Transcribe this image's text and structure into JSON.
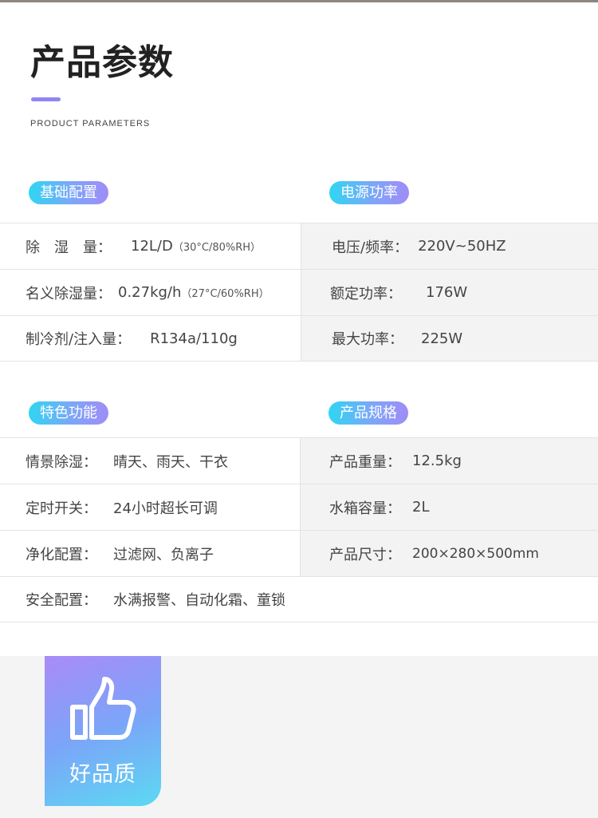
{
  "header": {
    "title": "产品参数",
    "subtitle": "PRODUCT PARAMETERS"
  },
  "sections": {
    "basic": {
      "label": "基础配置"
    },
    "power": {
      "label": "电源功率"
    },
    "features": {
      "label": "特色功能"
    },
    "specs": {
      "label": "产品规格"
    }
  },
  "table1": {
    "rows": [
      {
        "left_label": "除　湿　量：",
        "left_value": "12L/D",
        "left_note": "（30°C/80%RH）",
        "right_label": "电压/频率：",
        "right_value": "220V~50HZ"
      },
      {
        "left_label": "名义除湿量：",
        "left_value": "0.27kg/h",
        "left_note": "（27°C/60%RH）",
        "right_label": "额定功率：",
        "right_value": "176W"
      },
      {
        "left_label": "制冷剂/注入量：",
        "left_value": "R134a/110g",
        "left_note": "",
        "right_label": "最大功率：",
        "right_value": "225W"
      }
    ]
  },
  "table2": {
    "rows": [
      {
        "left_label": "情景除湿：",
        "left_value": "晴天、雨天、干衣",
        "right_label": "产品重量：",
        "right_value": "12.5kg"
      },
      {
        "left_label": "定时开关：",
        "left_value": "24小时超长可调",
        "right_label": "水箱容量：",
        "right_value": "2L"
      },
      {
        "left_label": "净化配置：",
        "left_value": "过滤网、负离子",
        "right_label": "产品尺寸：",
        "right_value": "200×280×500mm"
      }
    ],
    "full_row": {
      "label": "安全配置：",
      "value": "水满报警、自动化霜、童锁"
    }
  },
  "badge": {
    "icon": "thumbs-up-icon",
    "text": "好品质"
  },
  "colors": {
    "accent_purple": "#8f86f5",
    "pill_gradient_start": "#2fd6f2",
    "pill_gradient_end": "#a08cf7",
    "cell_gray": "#f3f3f3"
  }
}
